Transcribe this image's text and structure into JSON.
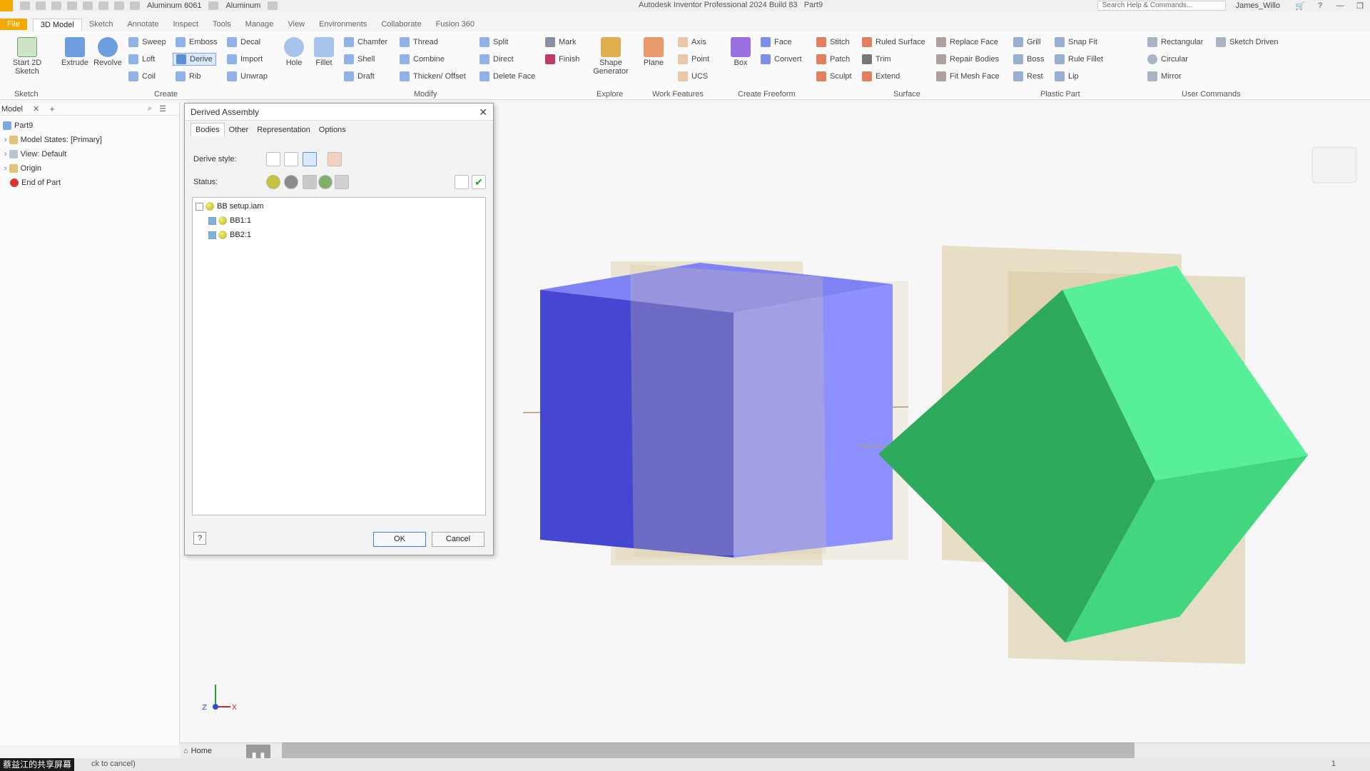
{
  "titlebar": {
    "material": "Aluminum 6061",
    "appearance": "Aluminum",
    "app_title": "Autodesk Inventor Professional 2024 Build 83",
    "doc": "Part9",
    "search_placeholder": "Search Help & Commands...",
    "user": "James_Willo"
  },
  "tabs": [
    "File",
    "3D Model",
    "Sketch",
    "Annotate",
    "Inspect",
    "Tools",
    "Manage",
    "View",
    "Environments",
    "Collaborate",
    "Fusion 360"
  ],
  "ribbon": {
    "start_sketch": "Start 2D Sketch",
    "extrude": "Extrude",
    "revolve": "Revolve",
    "sweep": "Sweep",
    "emboss": "Emboss",
    "decal": "Decal",
    "loft": "Loft",
    "derive": "Derive",
    "import": "Import",
    "coil": "Coil",
    "rib": "Rib",
    "unwrap": "Unwrap",
    "hole": "Hole",
    "fillet": "Fillet",
    "chamfer": "Chamfer",
    "thread": "Thread",
    "shell": "Shell",
    "combine": "Combine",
    "draft": "Draft",
    "thicken": "Thicken/ Offset",
    "split": "Split",
    "direct": "Direct",
    "delete_face": "Delete Face",
    "mark": "Mark",
    "finish": "Finish",
    "shape_gen": "Shape Generator",
    "plane": "Plane",
    "axis": "Axis",
    "point": "Point",
    "ucs": "UCS",
    "box": "Box",
    "face": "Face",
    "convert": "Convert",
    "stitch": "Stitch",
    "patch": "Patch",
    "sculpt": "Sculpt",
    "ruled_surface": "Ruled Surface",
    "trim": "Trim",
    "extend": "Extend",
    "replace_face": "Replace Face",
    "repair_bodies": "Repair Bodies",
    "fit_mesh": "Fit Mesh Face",
    "grill": "Grill",
    "boss": "Boss",
    "rest": "Rest",
    "snap_fit": "Snap Fit",
    "rule_fillet": "Rule Fillet",
    "lip": "Lip",
    "rectangular": "Rectangular",
    "circular": "Circular",
    "mirror": "Mirror",
    "sketch_driven": "Sketch Driven",
    "groups": {
      "sketch": "Sketch",
      "create": "Create",
      "modify": "Modify",
      "explore": "Explore",
      "work": "Work Features",
      "freeform": "Create Freeform",
      "surface": "Surface",
      "plastic": "Plastic Part",
      "user_cmds": "User Commands"
    }
  },
  "browser": {
    "tab": "Model",
    "items": [
      "Part9",
      "Model States: [Primary]",
      "View: Default",
      "Origin",
      "End of Part"
    ]
  },
  "dialog": {
    "title": "Derived Assembly",
    "tabs": [
      "Bodies",
      "Other",
      "Representation",
      "Options"
    ],
    "derive_style": "Derive style:",
    "status": "Status:",
    "tree": [
      "BB setup.iam",
      "BB1:1",
      "BB2:1"
    ],
    "ok": "OK",
    "cancel": "Cancel",
    "help": "?"
  },
  "bottom": {
    "home": "Home",
    "status_text": "ck to cancel)",
    "overlay": "蔡益江的共享屏幕",
    "page_num": "1"
  },
  "colors": {
    "accent": "#f2a900",
    "blue_cube": "#5a5ae0",
    "green_cube": "#3ccf7a",
    "planes": "#d8c8a0"
  }
}
